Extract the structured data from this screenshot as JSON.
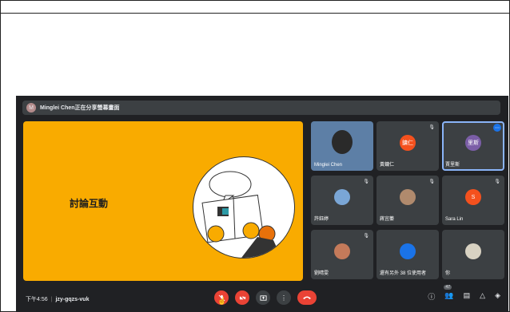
{
  "banner": {
    "presenter_text": "Minglei Chen正在分享螢幕畫面",
    "avatar_letter": "M"
  },
  "stage": {
    "title": "討論互動"
  },
  "tiles": [
    {
      "name": "Minglei Chen",
      "avatar": "",
      "color": "#6b8ec0",
      "muted": false
    },
    {
      "name": "黃鏞仁",
      "avatar": "鏞仁",
      "color": "#f4511e",
      "muted": true
    },
    {
      "name": "賈里斯",
      "avatar": "里斯",
      "color": "#7b5ea7",
      "muted": false
    },
    {
      "name": "許鈺婷",
      "avatar": "",
      "color": "#7aa6d6",
      "muted": true
    },
    {
      "name": "蔣宜蓁",
      "avatar": "",
      "color": "#b08a6d",
      "muted": true
    },
    {
      "name": "Sara Lin",
      "avatar": "S",
      "color": "#f4511e",
      "muted": true
    },
    {
      "name": "劉晴雯",
      "avatar": "",
      "color": "#c47a5a",
      "muted": true
    },
    {
      "name": "還有另外 38 位使用者",
      "avatar": "",
      "color": "#1a73e8",
      "muted": false
    },
    {
      "name": "你",
      "avatar": "",
      "color": "#d8d2c2",
      "muted": false
    }
  ],
  "bottom": {
    "time": "下午4:56",
    "meeting_code": "jzy-gqzs-vuk",
    "participant_count": "47"
  },
  "icons": {
    "mic": "mic-off-icon",
    "camera": "camera-off-icon",
    "present": "present-icon",
    "more": "more-options-icon",
    "leave": "hangup-icon",
    "info": "info-icon",
    "people": "people-icon",
    "chat": "chat-icon",
    "activities": "activities-icon",
    "host": "host-controls-icon"
  }
}
